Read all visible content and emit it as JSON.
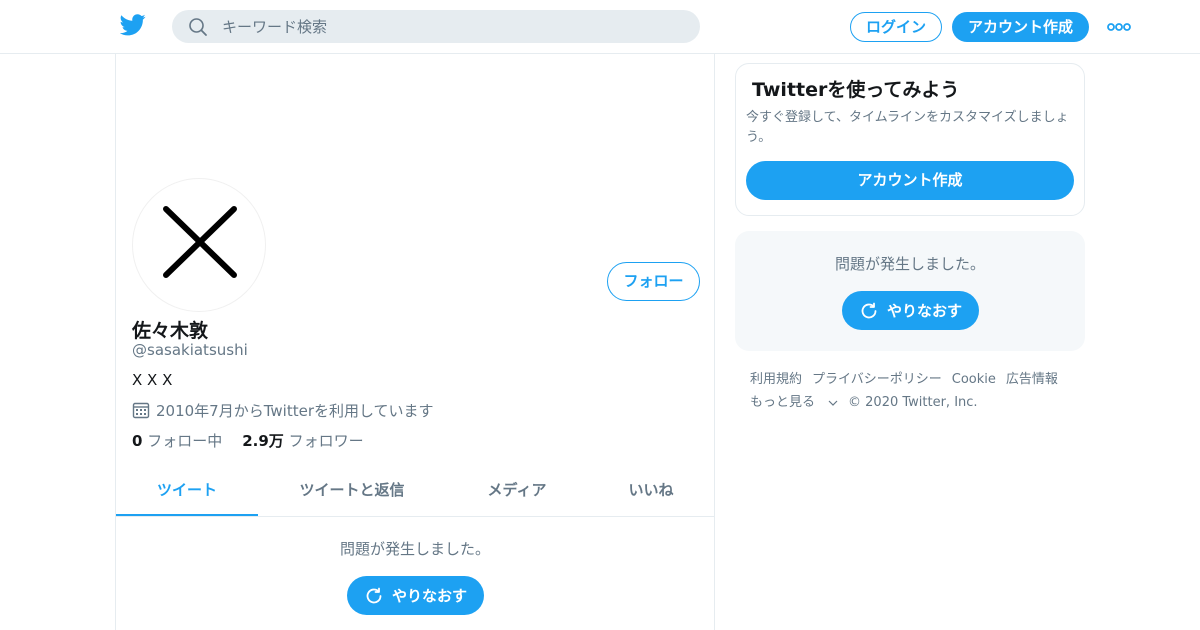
{
  "header": {
    "search_placeholder": "キーワード検索",
    "login_label": "ログイン",
    "signup_label": "アカウント作成"
  },
  "profile": {
    "follow_label": "フォロー",
    "name": "佐々木敦",
    "handle": "@sasakiatsushi",
    "bio": "X X X",
    "joined": "2010年7月からTwitterを利用しています",
    "following_count": "0",
    "following_label": "フォロー中",
    "followers_count": "2.9万",
    "followers_label": "フォロワー"
  },
  "tabs": [
    {
      "label": "ツイート",
      "active": true
    },
    {
      "label": "ツイートと返信",
      "active": false
    },
    {
      "label": "メディア",
      "active": false
    },
    {
      "label": "いいね",
      "active": false
    }
  ],
  "timeline": {
    "error_text": "問題が発生しました。",
    "retry_label": "やりなおす"
  },
  "sidebar": {
    "signup_card": {
      "title": "Twitterを使ってみよう",
      "description": "今すぐ登録して、タイムラインをカスタマイズしましょう。",
      "button_label": "アカウント作成"
    },
    "error_card": {
      "error_text": "問題が発生しました。",
      "retry_label": "やりなおす"
    },
    "footer": {
      "links": [
        "利用規約",
        "プライバシーポリシー",
        "Cookie",
        "広告情報"
      ],
      "more_label": "もっと見る",
      "copyright": "© 2020 Twitter, Inc."
    }
  },
  "colors": {
    "accent": "#1da1f2",
    "secondary_text": "#657786",
    "border": "#e6ecf0"
  },
  "icons": [
    "twitter-logo-icon",
    "search-icon",
    "more-icon",
    "calendar-icon",
    "refresh-icon",
    "chevron-down-icon"
  ]
}
